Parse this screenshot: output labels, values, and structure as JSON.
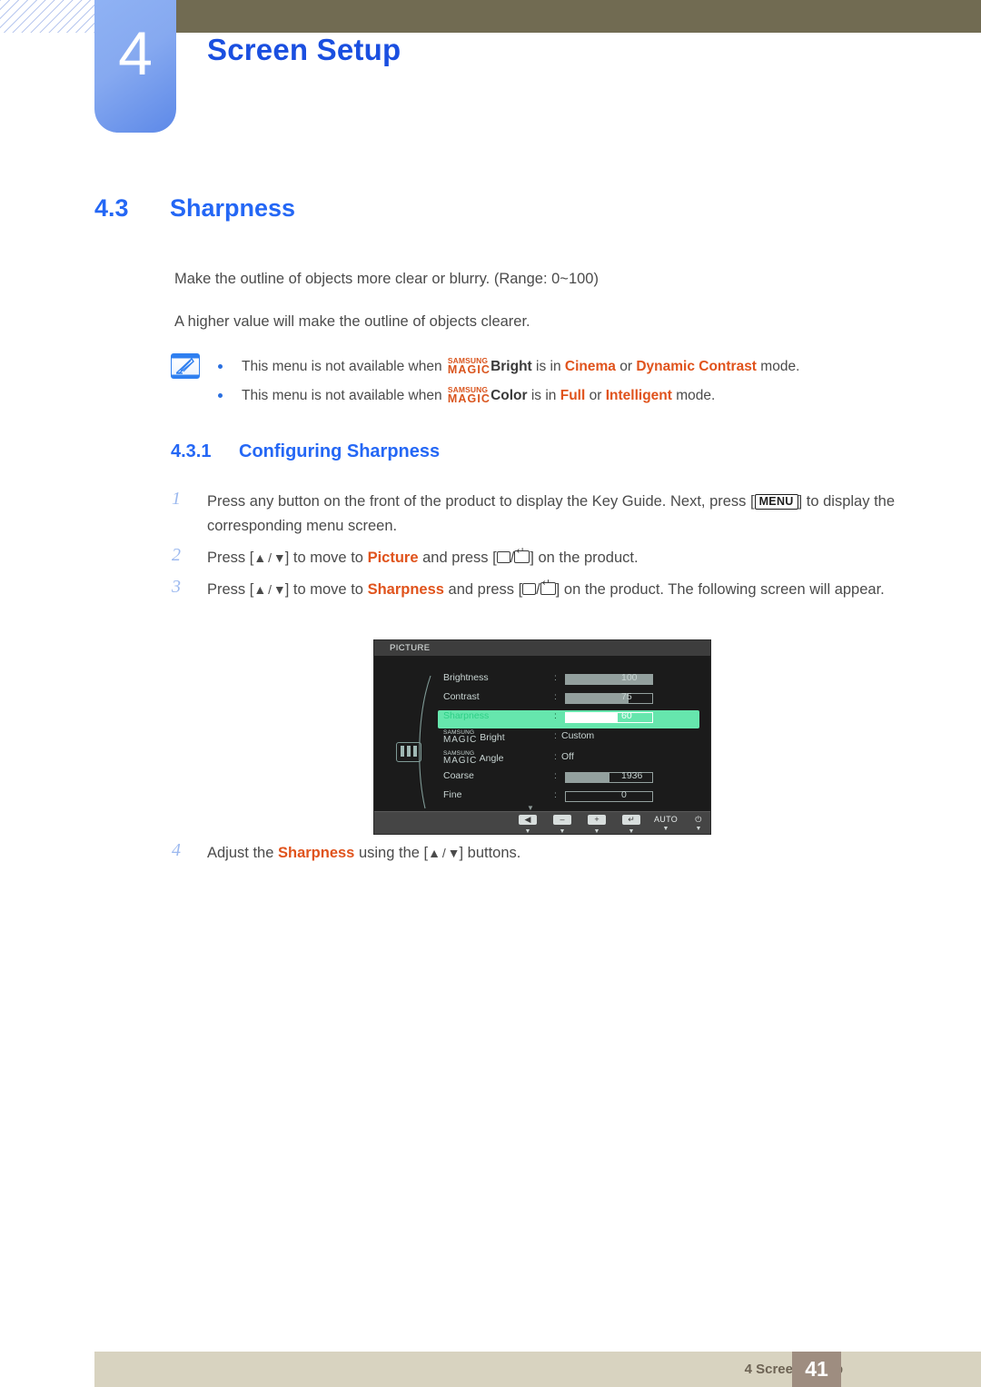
{
  "header": {
    "chapter_number": "4",
    "chapter_title": "Screen Setup"
  },
  "section": {
    "number": "4.3",
    "title": "Sharpness",
    "paragraphs": [
      "Make the outline of objects more clear or blurry. (Range: 0~100)",
      "A higher value will make the outline of objects clearer."
    ],
    "notes": {
      "icon": "note-pen-icon",
      "items": [
        {
          "prefix": "This menu is not available when",
          "brand_top": "SAMSUNG",
          "brand_bottom": "MAGIC",
          "feature": "Bright",
          "mid": "is in",
          "opt1": "Cinema",
          "conj": "or",
          "opt2": "Dynamic Contrast",
          "suffix": "mode."
        },
        {
          "prefix": "This menu is not available when",
          "brand_top": "SAMSUNG",
          "brand_bottom": "MAGIC",
          "feature": "Color",
          "mid": "is in",
          "opt1": "Full",
          "conj": "or",
          "opt2": "Intelligent",
          "suffix": "mode."
        }
      ]
    }
  },
  "subsection": {
    "number": "4.3.1",
    "title": "Configuring Sharpness"
  },
  "steps": [
    {
      "number": "1",
      "text_a": "Press any button on the front of the product to display the Key Guide. Next, press [",
      "key": "MENU",
      "text_b": "] to display the corresponding menu screen."
    },
    {
      "number": "2",
      "text_a": "Press [",
      "arrows": "▲ / ▼",
      "text_b": "] to move to",
      "target": "Picture",
      "text_c": "and press [",
      "text_d": "] on the product."
    },
    {
      "number": "3",
      "text_a": "Press [",
      "arrows": "▲ / ▼",
      "text_b": "] to move to",
      "target": "Sharpness",
      "text_c": "and press [",
      "text_d": "] on the product. The following screen will appear."
    },
    {
      "number": "4",
      "text_a": "Adjust the",
      "target": "Sharpness",
      "text_b": "using the [",
      "arrows": "▲ / ▼",
      "text_c": "] buttons."
    }
  ],
  "osd": {
    "title": "PICTURE",
    "category_icon": "picture-bars-icon",
    "rows": [
      {
        "label": "Brightness",
        "type": "bar",
        "value": "100",
        "fill_pct": 100,
        "highlight": false
      },
      {
        "label": "Contrast",
        "type": "bar",
        "value": "75",
        "fill_pct": 73,
        "highlight": false
      },
      {
        "label": "Sharpness",
        "type": "bar",
        "value": "60",
        "fill_pct": 60,
        "highlight": true
      },
      {
        "label": "Bright",
        "brand_top": "SAMSUNG",
        "brand_bottom": "MAGIC",
        "type": "text",
        "value": "Custom",
        "highlight": false
      },
      {
        "label": "Angle",
        "brand_top": "SAMSUNG",
        "brand_bottom": "MAGIC",
        "type": "text",
        "value": "Off",
        "highlight": false
      },
      {
        "label": "Coarse",
        "type": "bar",
        "value": "1936",
        "fill_pct": 51,
        "highlight": false
      },
      {
        "label": "Fine",
        "type": "bar",
        "value": "0",
        "fill_pct": 0,
        "highlight": false
      }
    ],
    "scroll_hint": "▼",
    "toolbar": [
      {
        "icon": "left-arrow-key",
        "glyph": "◀",
        "kind": "key"
      },
      {
        "icon": "minus-key",
        "glyph": "–",
        "kind": "key"
      },
      {
        "icon": "plus-key",
        "glyph": "+",
        "kind": "key"
      },
      {
        "icon": "enter-key",
        "glyph": "↵",
        "kind": "key"
      },
      {
        "icon": "auto-key",
        "glyph": "AUTO",
        "kind": "text"
      },
      {
        "icon": "power-key",
        "glyph": "⏻",
        "kind": "text"
      }
    ]
  },
  "footer": {
    "text": "4 Screen Setup",
    "page": "41"
  },
  "colors": {
    "heading_blue": "#2467f5",
    "chapter_blue": "#1a4fe0",
    "accent_orange": "#e0531c",
    "samsung_magic": "#d9541d",
    "olive_bar": "#716b52",
    "footer_bar": "#d8d3c0",
    "page_box": "#9e8d80",
    "osd_highlight": "#66e6ad",
    "osd_bg": "#1b1b1b"
  }
}
